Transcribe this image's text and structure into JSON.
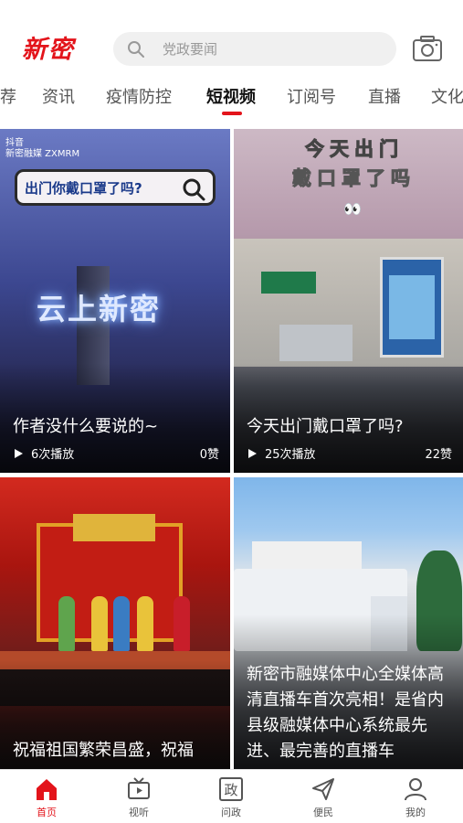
{
  "header": {
    "logo": "新密",
    "search_placeholder": "党政要闻"
  },
  "tabs": [
    {
      "label": "荐",
      "active": false
    },
    {
      "label": "资讯",
      "active": false
    },
    {
      "label": "疫情防控",
      "active": false
    },
    {
      "label": "短视频",
      "active": true
    },
    {
      "label": "订阅号",
      "active": false
    },
    {
      "label": "直播",
      "active": false
    },
    {
      "label": "文化",
      "active": false
    }
  ],
  "cards": [
    {
      "title": "作者没什么要说的~",
      "plays": "6次播放",
      "likes": "0赞",
      "overlay_search": "出门你戴口罩了吗?",
      "overlay_text": "云上新密",
      "brand": "抖音\n新密融媒 ZXMRM"
    },
    {
      "title": "今天出门戴口罩了吗?",
      "plays": "25次播放",
      "likes": "22赞",
      "overlay_line1": "今天出门",
      "overlay_line2": "戴口罩了吗",
      "overlay_eyes": "👀"
    },
    {
      "title": "祝福祖国繁荣昌盛，祝福"
    },
    {
      "title": "新密市融媒体中心全媒体高清直播车首次亮相！是省内县级融媒体中心系统最先进、最完善的直播车"
    }
  ],
  "bottom_nav": [
    {
      "label": "首页",
      "icon": "home-icon",
      "active": true
    },
    {
      "label": "视听",
      "icon": "tv-icon",
      "active": false
    },
    {
      "label": "问政",
      "icon": "zheng-icon",
      "active": false
    },
    {
      "label": "便民",
      "icon": "send-icon",
      "active": false
    },
    {
      "label": "我的",
      "icon": "user-icon",
      "active": false
    }
  ],
  "colors": {
    "accent": "#e3141b"
  }
}
